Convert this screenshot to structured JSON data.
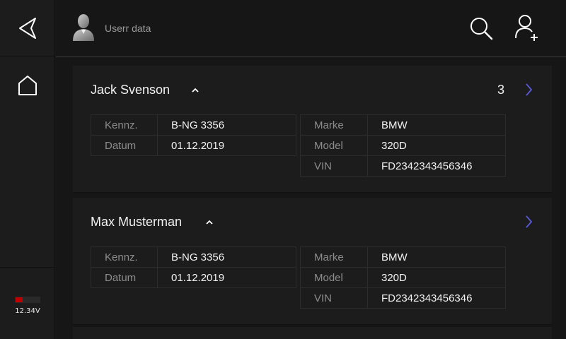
{
  "header": {
    "title": "Userr data"
  },
  "status": {
    "battery_voltage": "12.34V",
    "battery_level": 0.3
  },
  "icons": {
    "back": "back-arrow-icon",
    "home": "home-icon",
    "search": "search-icon",
    "add_user": "add-user-icon",
    "avatar": "user-avatar-icon"
  },
  "colors": {
    "background": "#161616",
    "card": "#1c1c1c",
    "chevron": "#5a5adc",
    "battery": "#c00000"
  },
  "users": [
    {
      "name": "Jack Svenson",
      "count": "3",
      "left_rows": [
        {
          "label": "Kennz.",
          "value": "B-NG 3356"
        },
        {
          "label": "Datum",
          "value": "01.12.2019"
        }
      ],
      "right_rows": [
        {
          "label": "Marke",
          "value": "BMW"
        },
        {
          "label": "Model",
          "value": "320D"
        },
        {
          "label": "VIN",
          "value": "FD2342343456346"
        }
      ]
    },
    {
      "name": "Max Musterman",
      "count": "",
      "left_rows": [
        {
          "label": "Kennz.",
          "value": "B-NG 3356"
        },
        {
          "label": "Datum",
          "value": "01.12.2019"
        }
      ],
      "right_rows": [
        {
          "label": "Marke",
          "value": "BMW"
        },
        {
          "label": "Model",
          "value": "320D"
        },
        {
          "label": "VIN",
          "value": "FD2342343456346"
        }
      ]
    }
  ]
}
